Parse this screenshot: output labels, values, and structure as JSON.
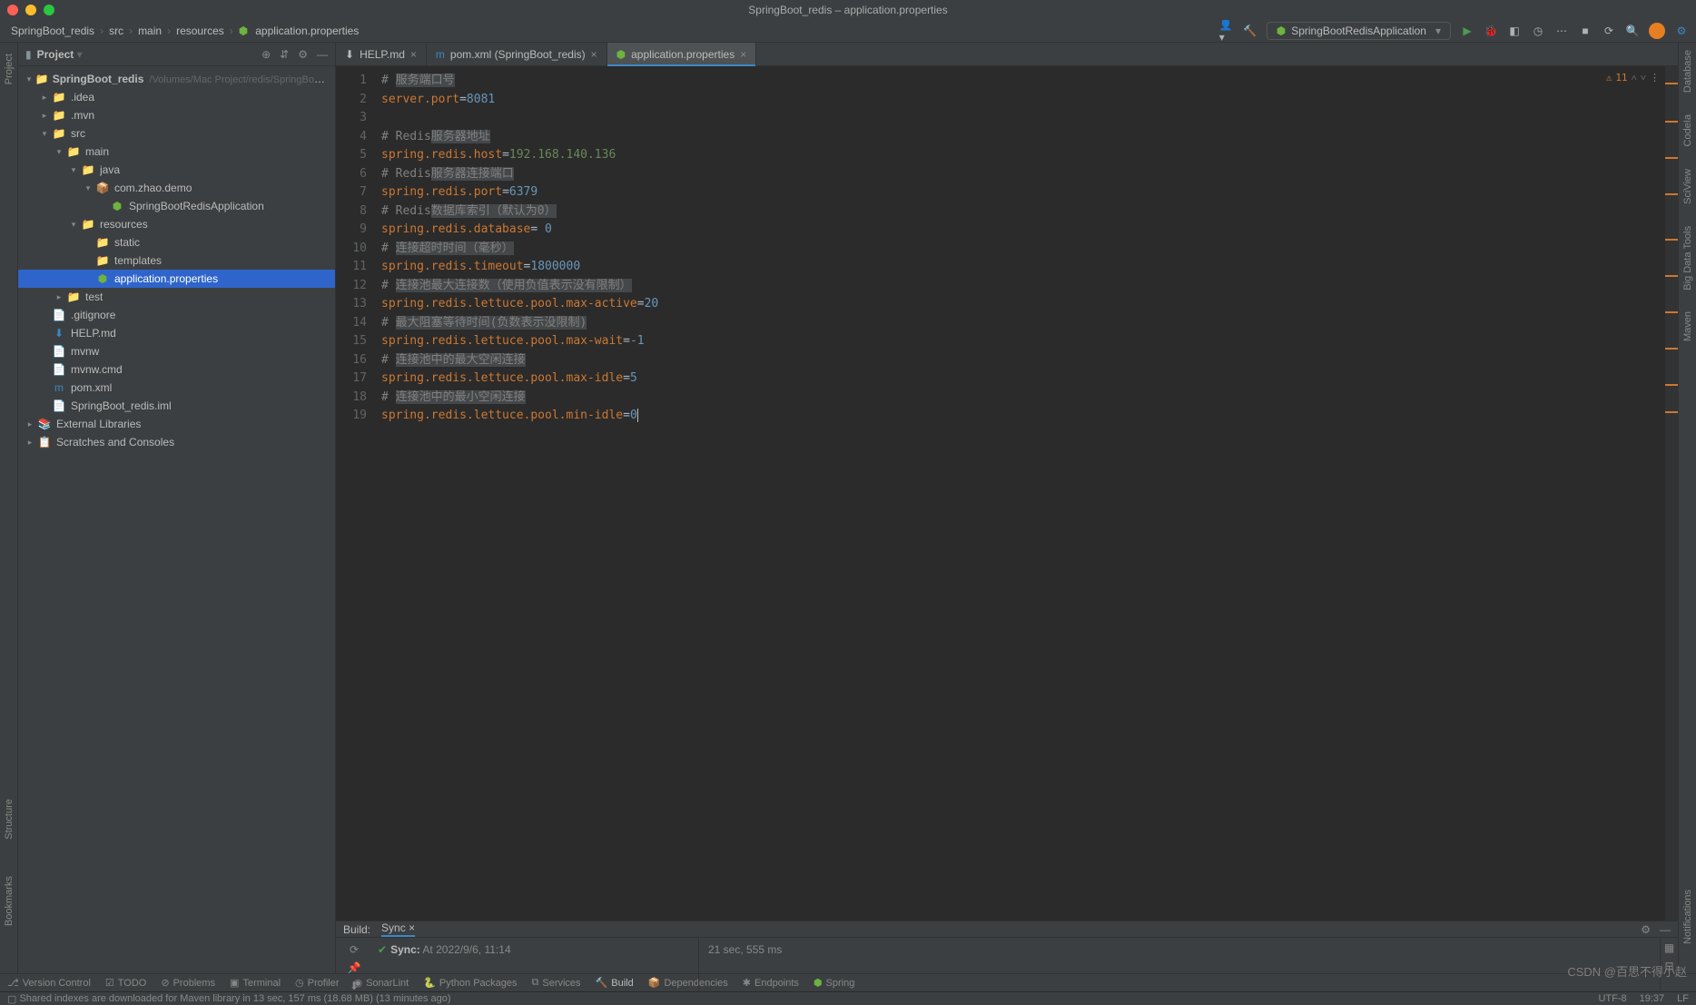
{
  "title": "SpringBoot_redis – application.properties",
  "breadcrumbs": [
    "SpringBoot_redis",
    "src",
    "main",
    "resources",
    "application.properties"
  ],
  "runConfig": "SpringBootRedisApplication",
  "projectPanel": {
    "title": "Project"
  },
  "tree": {
    "root": {
      "name": "SpringBoot_redis",
      "hint": "/Volumes/Mac Project/redis/SpringBoot_redis/Spri"
    },
    "idea": ".idea",
    "mvn": ".mvn",
    "src": "src",
    "main": "main",
    "java": "java",
    "pkg": "com.zhao.demo",
    "app": "SpringBootRedisApplication",
    "resources": "resources",
    "static": "static",
    "templates": "templates",
    "props": "application.properties",
    "test": "test",
    "gitignore": ".gitignore",
    "help": "HELP.md",
    "mvnw": "mvnw",
    "mvnwcmd": "mvnw.cmd",
    "pom": "pom.xml",
    "iml": "SpringBoot_redis.iml",
    "extlib": "External Libraries",
    "scratches": "Scratches and Consoles"
  },
  "tabs": {
    "t1": "HELP.md",
    "t2": "pom.xml (SpringBoot_redis)",
    "t3": "application.properties"
  },
  "editor": {
    "lines": [
      "1",
      "2",
      "3",
      "4",
      "5",
      "6",
      "7",
      "8",
      "9",
      "10",
      "11",
      "12",
      "13",
      "14",
      "15",
      "16",
      "17",
      "18",
      "19"
    ]
  },
  "code": {
    "c1a": "# ",
    "c1b": "服务端口号",
    "c2a": "server.port",
    "c2b": "=",
    "c2c": "8081",
    "c4a": "# Redis",
    "c4b": "服务器地址",
    "c5a": "spring.redis.host",
    "c5b": "=",
    "c5c": "192.168.140.136",
    "c6a": "# Redis",
    "c6b": "服务器连接端口",
    "c7a": "spring.redis.port",
    "c7b": "=",
    "c7c": "6379",
    "c8a": "# Redis",
    "c8b": "数据库索引（默认为0）",
    "c9a": "spring.redis.database",
    "c9b": "= ",
    "c9c": "0",
    "c10a": "# ",
    "c10b": "连接超时时间（毫秒）",
    "c11a": "spring.redis.timeout",
    "c11b": "=",
    "c11c": "1800000",
    "c12a": "# ",
    "c12b": "连接池最大连接数（使用负值表示没有限制）",
    "c13a": "spring.redis.lettuce.pool.max-active",
    "c13b": "=",
    "c13c": "20",
    "c14a": "# ",
    "c14b": "最大阻塞等待时间(负数表示没限制)",
    "c15a": "spring.redis.lettuce.pool.max-wait",
    "c15b": "=",
    "c15c": "-1",
    "c16a": "# ",
    "c16b": "连接池中的最大空闲连接",
    "c17a": "spring.redis.lettuce.pool.max-idle",
    "c17b": "=",
    "c17c": "5",
    "c18a": "# ",
    "c18b": "连接池中的最小空闲连接",
    "c19a": "spring.redis.lettuce.pool.min-idle",
    "c19b": "=",
    "c19c": "0"
  },
  "inspection": {
    "warn_count": "11"
  },
  "build": {
    "label": "Build:",
    "tab": "Sync",
    "sync_label": "Sync:",
    "sync_time": "At 2022/9/6, 11:14",
    "duration": "21 sec, 555 ms"
  },
  "bottomTools": {
    "vc": "Version Control",
    "todo": "TODO",
    "problems": "Problems",
    "terminal": "Terminal",
    "profiler": "Profiler",
    "sonar": "SonarLint",
    "pypkg": "Python Packages",
    "services": "Services",
    "build": "Build",
    "deps": "Dependencies",
    "endpoints": "Endpoints",
    "spring": "Spring"
  },
  "status": {
    "msg": "Shared indexes are downloaded for Maven library in 13 sec, 157 ms (18.68 MB) (13 minutes ago)",
    "encoding": "UTF-8",
    "pos": "19:37",
    "lf": "LF"
  },
  "leftRail": {
    "l1": "Project",
    "l2": "Bookmarks",
    "l3": "Structure"
  },
  "rightRail": {
    "r1": "Database",
    "r2": "CodeIa",
    "r3": "SciView",
    "r4": "Big Data Tools",
    "r5": "Maven",
    "r6": "Notifications"
  },
  "watermark": "CSDN @百思不得小赵"
}
